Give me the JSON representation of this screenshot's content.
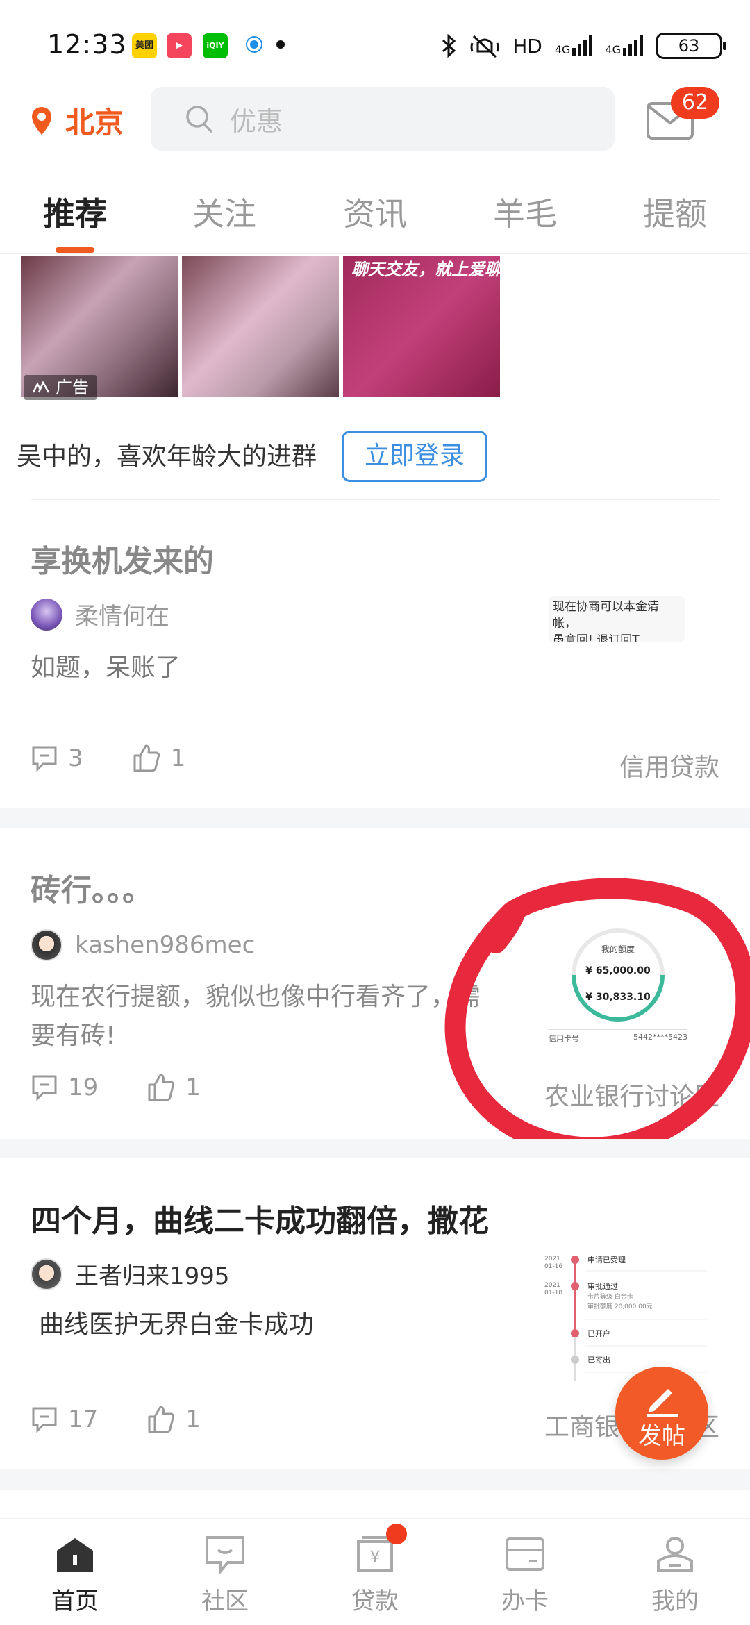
{
  "status_bar": {
    "time": "12:33",
    "app_icons": [
      {
        "name": "meituan-icon",
        "label": "美团",
        "color": "#ffd100"
      },
      {
        "name": "video-icon",
        "label": "▶",
        "color": "#f5455c"
      },
      {
        "name": "iqiyi-icon",
        "label": "iQIY",
        "color": "#00be06"
      }
    ],
    "network": "HD",
    "signal_1": "4G",
    "signal_2": "4G",
    "battery": "63"
  },
  "header": {
    "city": "北京",
    "search_placeholder": "优惠",
    "mail_badge": "62"
  },
  "tabs": [
    {
      "label": "推荐",
      "active": true
    },
    {
      "label": "关注",
      "active": false
    },
    {
      "label": "资讯",
      "active": false
    },
    {
      "label": "羊毛",
      "active": false
    },
    {
      "label": "提额",
      "active": false
    }
  ],
  "ad": {
    "tag": "广告",
    "image_text": "聊天交友，就上爱聊！",
    "line": "吴中的，喜欢年龄大的进群",
    "login_button": "立即登录"
  },
  "posts": [
    {
      "title": "享换机发来的",
      "author": "柔情何在",
      "body": "如题，呆账了",
      "comments": "3",
      "likes": "1",
      "category": "信用贷款",
      "thumb_text": [
        "现在协商可以本金清帐，",
        "愚意回!.退订回T"
      ]
    },
    {
      "title": "砖行。。。",
      "author": "kashen986mec",
      "body_lines": [
        "现在农行提额，貌似也像中行看齐了，需",
        "要有砖!"
      ],
      "comments": "19",
      "likes": "1",
      "category": "农业银行讨论区",
      "thumb": {
        "label": "我的额度",
        "amount_1": "¥ 65,000.00",
        "amount_2": "¥ 30,833.10",
        "card_label": "信用卡号",
        "card_no": "5442****5423"
      }
    },
    {
      "title": "四个月，曲线二卡成功翻倍，撒花",
      "author": "王者归来1995",
      "body": "曲线医护无界白金卡成功",
      "comments": "17",
      "likes": "1",
      "category": "工商银行讨论区",
      "thumb": {
        "steps": [
          {
            "date": "2021 01-16",
            "label": "申请已受理"
          },
          {
            "date": "2021 01-18",
            "label": "审批通过",
            "detail_1": "卡片等级   白金卡",
            "detail_2": "审批额度   20,000.00元"
          },
          {
            "date": "",
            "label": "已开户"
          },
          {
            "date": "",
            "label": "已寄出"
          }
        ]
      }
    }
  ],
  "fab_label": "发帖",
  "bottom_nav": [
    {
      "label": "首页",
      "active": true
    },
    {
      "label": "社区",
      "active": false
    },
    {
      "label": "贷款",
      "active": false
    },
    {
      "label": "办卡",
      "active": false
    },
    {
      "label": "我的",
      "active": false
    }
  ],
  "colors": {
    "accent": "#f05a1e",
    "link": "#3c8fe0",
    "annotation": "#e8283c"
  }
}
